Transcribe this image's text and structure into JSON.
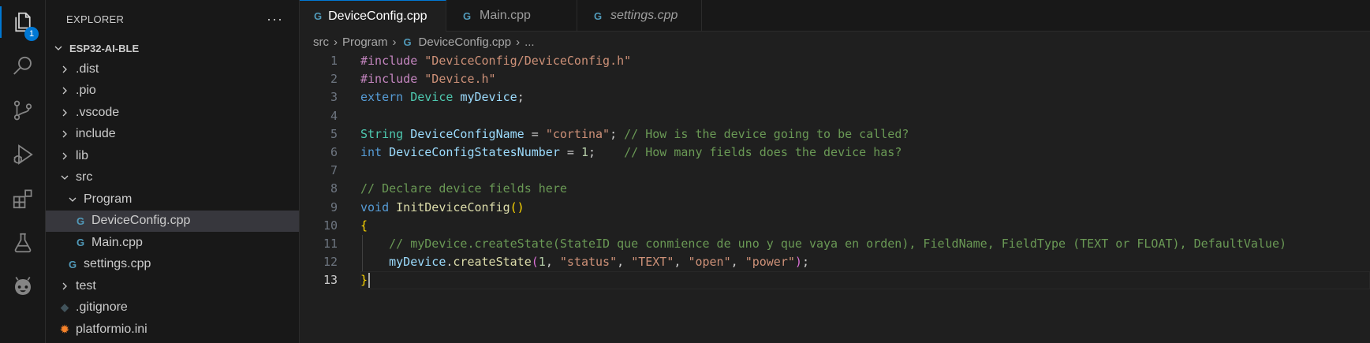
{
  "activity_bar": {
    "explorer_badge": "1",
    "items": [
      "files-icon",
      "search-icon",
      "source-control-icon",
      "run-debug-icon",
      "extensions-icon",
      "testing-icon",
      "platformio-icon"
    ]
  },
  "sidebar": {
    "title": "EXPLORER",
    "more": "···",
    "project": "ESP32-AI-BLE",
    "tree": [
      {
        "label": ".dist",
        "type": "folder",
        "expanded": false,
        "depth": 1
      },
      {
        "label": ".pio",
        "type": "folder",
        "expanded": false,
        "depth": 1
      },
      {
        "label": ".vscode",
        "type": "folder",
        "expanded": false,
        "depth": 1
      },
      {
        "label": "include",
        "type": "folder",
        "expanded": false,
        "depth": 1
      },
      {
        "label": "lib",
        "type": "folder",
        "expanded": false,
        "depth": 1
      },
      {
        "label": "src",
        "type": "folder",
        "expanded": true,
        "depth": 1
      },
      {
        "label": "Program",
        "type": "folder",
        "expanded": true,
        "depth": 2
      },
      {
        "label": "DeviceConfig.cpp",
        "type": "cpp",
        "depth": 3,
        "selected": true
      },
      {
        "label": "Main.cpp",
        "type": "cpp",
        "depth": 3
      },
      {
        "label": "settings.cpp",
        "type": "cpp",
        "depth": 2
      },
      {
        "label": "test",
        "type": "folder",
        "expanded": false,
        "depth": 1
      },
      {
        "label": ".gitignore",
        "type": "git",
        "depth": 1
      },
      {
        "label": "platformio.ini",
        "type": "pio",
        "depth": 1
      }
    ]
  },
  "tabs": [
    {
      "label": "DeviceConfig.cpp",
      "active": true,
      "modified": true
    },
    {
      "label": "Main.cpp",
      "active": false
    },
    {
      "label": "settings.cpp",
      "active": false,
      "italic": true
    }
  ],
  "breadcrumb": {
    "parts": [
      "src",
      "Program",
      "DeviceConfig.cpp",
      "..."
    ]
  },
  "editor": {
    "current_line": 13,
    "lines": [
      {
        "n": "1",
        "tokens": [
          [
            "kw-dir",
            "#include"
          ],
          [
            "pl",
            " "
          ],
          [
            "str",
            "\"DeviceConfig/DeviceConfig.h\""
          ]
        ]
      },
      {
        "n": "2",
        "tokens": [
          [
            "kw-dir",
            "#include"
          ],
          [
            "pl",
            " "
          ],
          [
            "str",
            "\"Device.h\""
          ]
        ]
      },
      {
        "n": "3",
        "tokens": [
          [
            "kw",
            "extern"
          ],
          [
            "pl",
            " "
          ],
          [
            "type",
            "Device"
          ],
          [
            "pl",
            " "
          ],
          [
            "var",
            "myDevice"
          ],
          [
            "pl",
            ";"
          ]
        ]
      },
      {
        "n": "4",
        "tokens": []
      },
      {
        "n": "5",
        "tokens": [
          [
            "type",
            "String"
          ],
          [
            "pl",
            " "
          ],
          [
            "var",
            "DeviceConfigName"
          ],
          [
            "pl",
            " = "
          ],
          [
            "str",
            "\"cortina\""
          ],
          [
            "pl",
            "; "
          ],
          [
            "com",
            "// How is the device going to be called?"
          ]
        ]
      },
      {
        "n": "6",
        "tokens": [
          [
            "kw",
            "int"
          ],
          [
            "pl",
            " "
          ],
          [
            "var",
            "DeviceConfigStatesNumber"
          ],
          [
            "pl",
            " = "
          ],
          [
            "num",
            "1"
          ],
          [
            "pl",
            ";    "
          ],
          [
            "com",
            "// How many fields does the device has?"
          ]
        ]
      },
      {
        "n": "7",
        "tokens": []
      },
      {
        "n": "8",
        "tokens": [
          [
            "com",
            "// Declare device fields here"
          ]
        ]
      },
      {
        "n": "9",
        "tokens": [
          [
            "kw",
            "void"
          ],
          [
            "pl",
            " "
          ],
          [
            "fn",
            "InitDeviceConfig"
          ],
          [
            "br1",
            "()"
          ]
        ]
      },
      {
        "n": "10",
        "tokens": [
          [
            "br1",
            "{"
          ]
        ]
      },
      {
        "n": "11",
        "tokens": [
          [
            "pl",
            "    "
          ],
          [
            "com",
            "// myDevice.createState(StateID que conmience de uno y que vaya en orden), FieldName, FieldType (TEXT or FLOAT), DefaultValue)"
          ]
        ]
      },
      {
        "n": "12",
        "tokens": [
          [
            "pl",
            "    "
          ],
          [
            "var",
            "myDevice"
          ],
          [
            "pl",
            "."
          ],
          [
            "fn",
            "createState"
          ],
          [
            "br2",
            "("
          ],
          [
            "num",
            "1"
          ],
          [
            "pl",
            ", "
          ],
          [
            "str",
            "\"status\""
          ],
          [
            "pl",
            ", "
          ],
          [
            "str",
            "\"TEXT\""
          ],
          [
            "pl",
            ", "
          ],
          [
            "str",
            "\"open\""
          ],
          [
            "pl",
            ", "
          ],
          [
            "str",
            "\"power\""
          ],
          [
            "br2",
            ")"
          ],
          [
            "pl",
            ";"
          ]
        ]
      },
      {
        "n": "13",
        "tokens": [
          [
            "br1",
            "}"
          ]
        ]
      }
    ]
  },
  "colors": {
    "accent": "#0078d4",
    "background": "#1f1f1f",
    "sidebar": "#181818",
    "selection": "#37373d"
  }
}
